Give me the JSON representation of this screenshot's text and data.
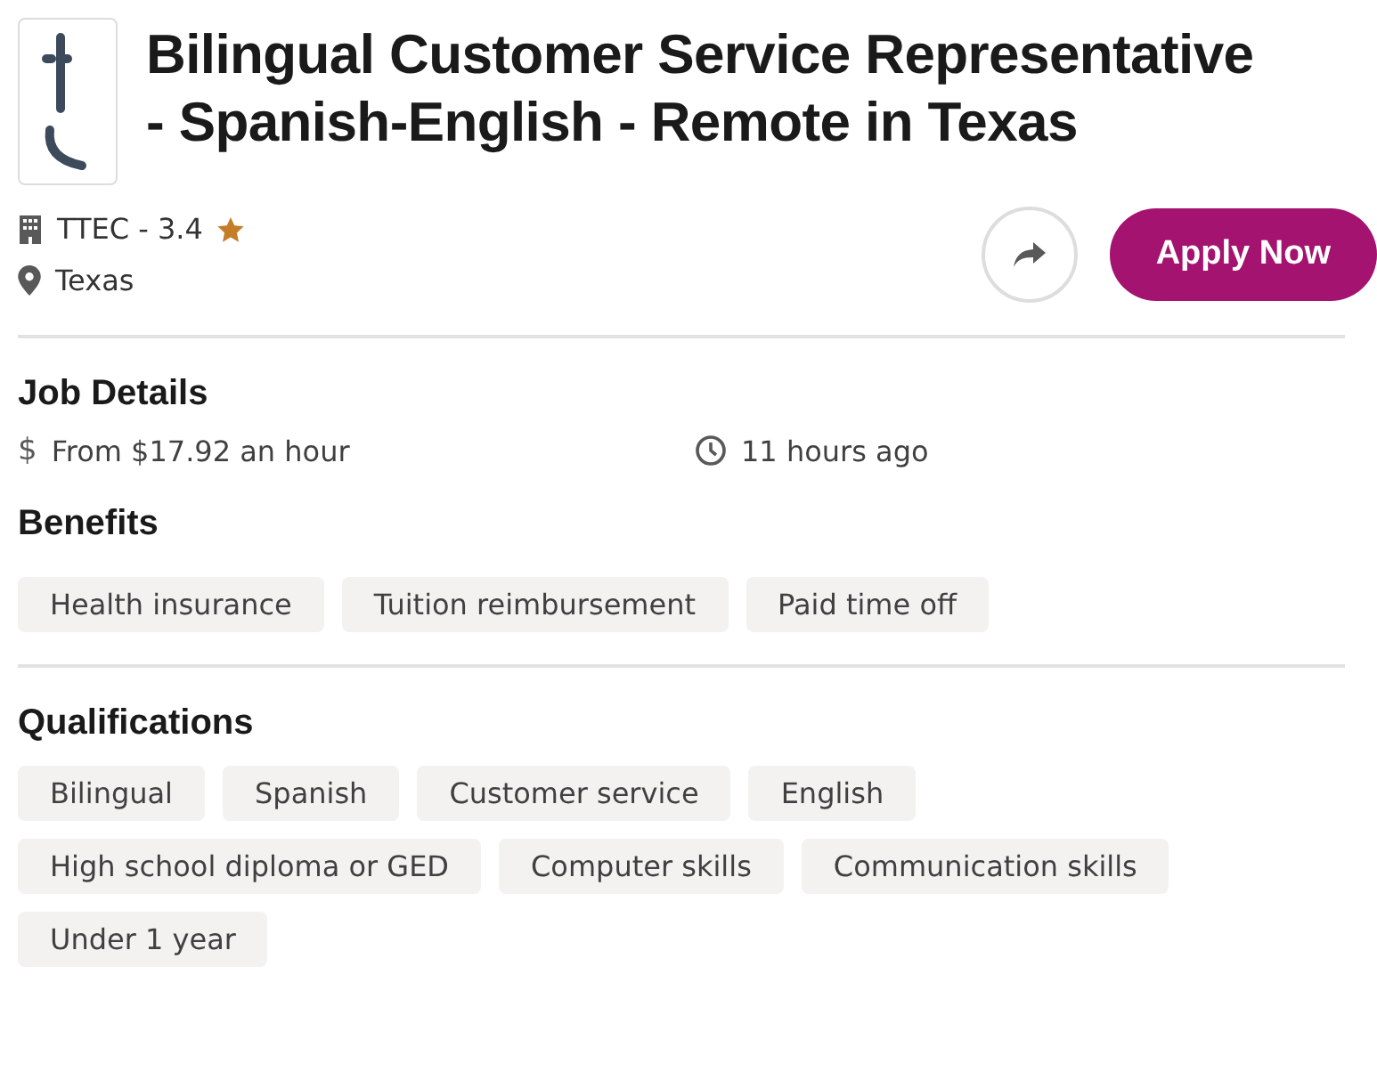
{
  "job": {
    "title_lines": [
      "Bilingual Customer Service Representative",
      "- Spanish-English - Remote in Texas"
    ],
    "company": "TTEC - 3.4",
    "location": "Texas"
  },
  "actions": {
    "apply": "Apply Now"
  },
  "job_details": {
    "heading": "Job Details",
    "pay_symbol": "$",
    "pay": "From $17.92 an hour",
    "posted": "11 hours ago"
  },
  "benefits": {
    "heading": "Benefits",
    "tags": [
      "Health insurance",
      "Tuition reimbursement",
      "Paid time off"
    ]
  },
  "qualifications": {
    "heading": "Qualifications",
    "tags": [
      "Bilingual",
      "Spanish",
      "Customer service",
      "English",
      "High school diploma or GED",
      "Computer skills",
      "Communication skills",
      "Under 1 year"
    ]
  }
}
